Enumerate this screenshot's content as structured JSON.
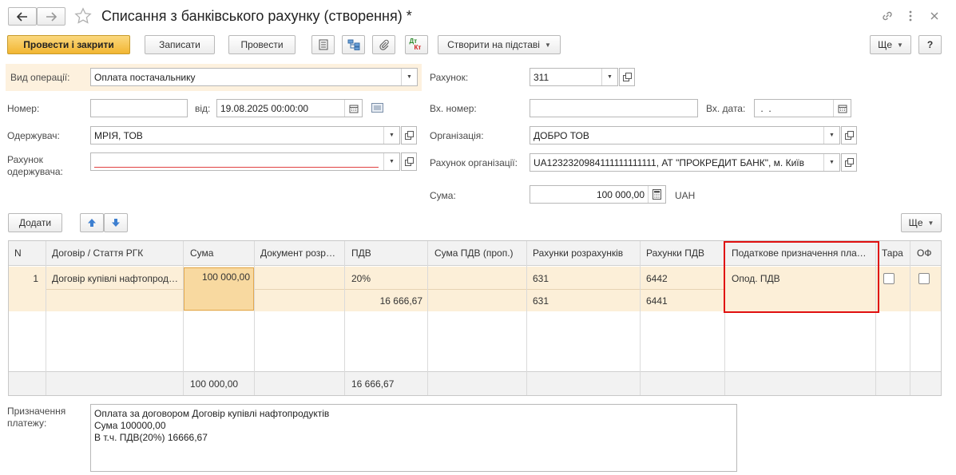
{
  "window": {
    "title": "Списання з банківського рахунку (створення) *"
  },
  "toolbar": {
    "post_close": "Провести і закрити",
    "save": "Записати",
    "post": "Провести",
    "dtkt_top": "Дт",
    "dtkt_bottom": "Кт",
    "create_based": "Створити на підставі",
    "more": "Ще",
    "help": "?"
  },
  "form": {
    "op_type_label": "Вид операції:",
    "op_type_value": "Оплата постачальнику",
    "number_label": "Номер:",
    "number_value": "",
    "date_label": "від:",
    "date_value": "19.08.2025 00:00:00",
    "recipient_label": "Одержувач:",
    "recipient_value": "МРІЯ, ТОВ",
    "recipient_account_label": "Рахунок одержувача:",
    "recipient_account_value": "",
    "account_label": "Рахунок:",
    "account_value": "311",
    "in_number_label": "Вх. номер:",
    "in_number_value": "",
    "in_date_label": "Вх. дата:",
    "in_date_value": " .  .",
    "org_label": "Організація:",
    "org_value": "ДОБРО ТОВ",
    "org_account_label": "Рахунок організації:",
    "org_account_value": "UA1232320984111111111111, АТ \"ПРОКРЕДИТ БАНК\", м. Київ",
    "sum_label": "Сума:",
    "sum_value": "100 000,00",
    "currency": "UAH"
  },
  "table_toolbar": {
    "add": "Додати",
    "more": "Ще"
  },
  "table": {
    "columns": [
      "N",
      "Договір / Стаття РГК",
      "Сума",
      "Документ розрахунків",
      "ПДВ",
      "Сума ПДВ (проп.)",
      "Рахунки розрахунків",
      "Рахунки ПДВ",
      "Податкове призначення платежу",
      "Тара",
      "ОФ"
    ],
    "rows": [
      {
        "n": "1",
        "contract": "Договір купівлі нафтопродуктів",
        "sum": "100 000,00",
        "doc": "",
        "vat_rate": "20%",
        "vat_amount": "16 666,67",
        "vat_prop": "",
        "acc_settle_1": "631",
        "acc_settle_2": "631",
        "acc_vat_1": "6442",
        "acc_vat_2": "6441",
        "tax_purpose": "Опод. ПДВ"
      }
    ],
    "totals": {
      "sum": "100 000,00",
      "vat": "16 666,67"
    }
  },
  "purpose": {
    "label": "Призначення платежу:",
    "text": "Оплата за договором Договір купівлі нафтопродуктів\nСума 100000,00\nВ т.ч. ПДВ(20%) 16666,67"
  },
  "colors": {
    "highlight": "#e01010",
    "primary_button": "#f2b632",
    "row_selected": "#fcefd8",
    "op_type_bg": "#fdf1de"
  }
}
